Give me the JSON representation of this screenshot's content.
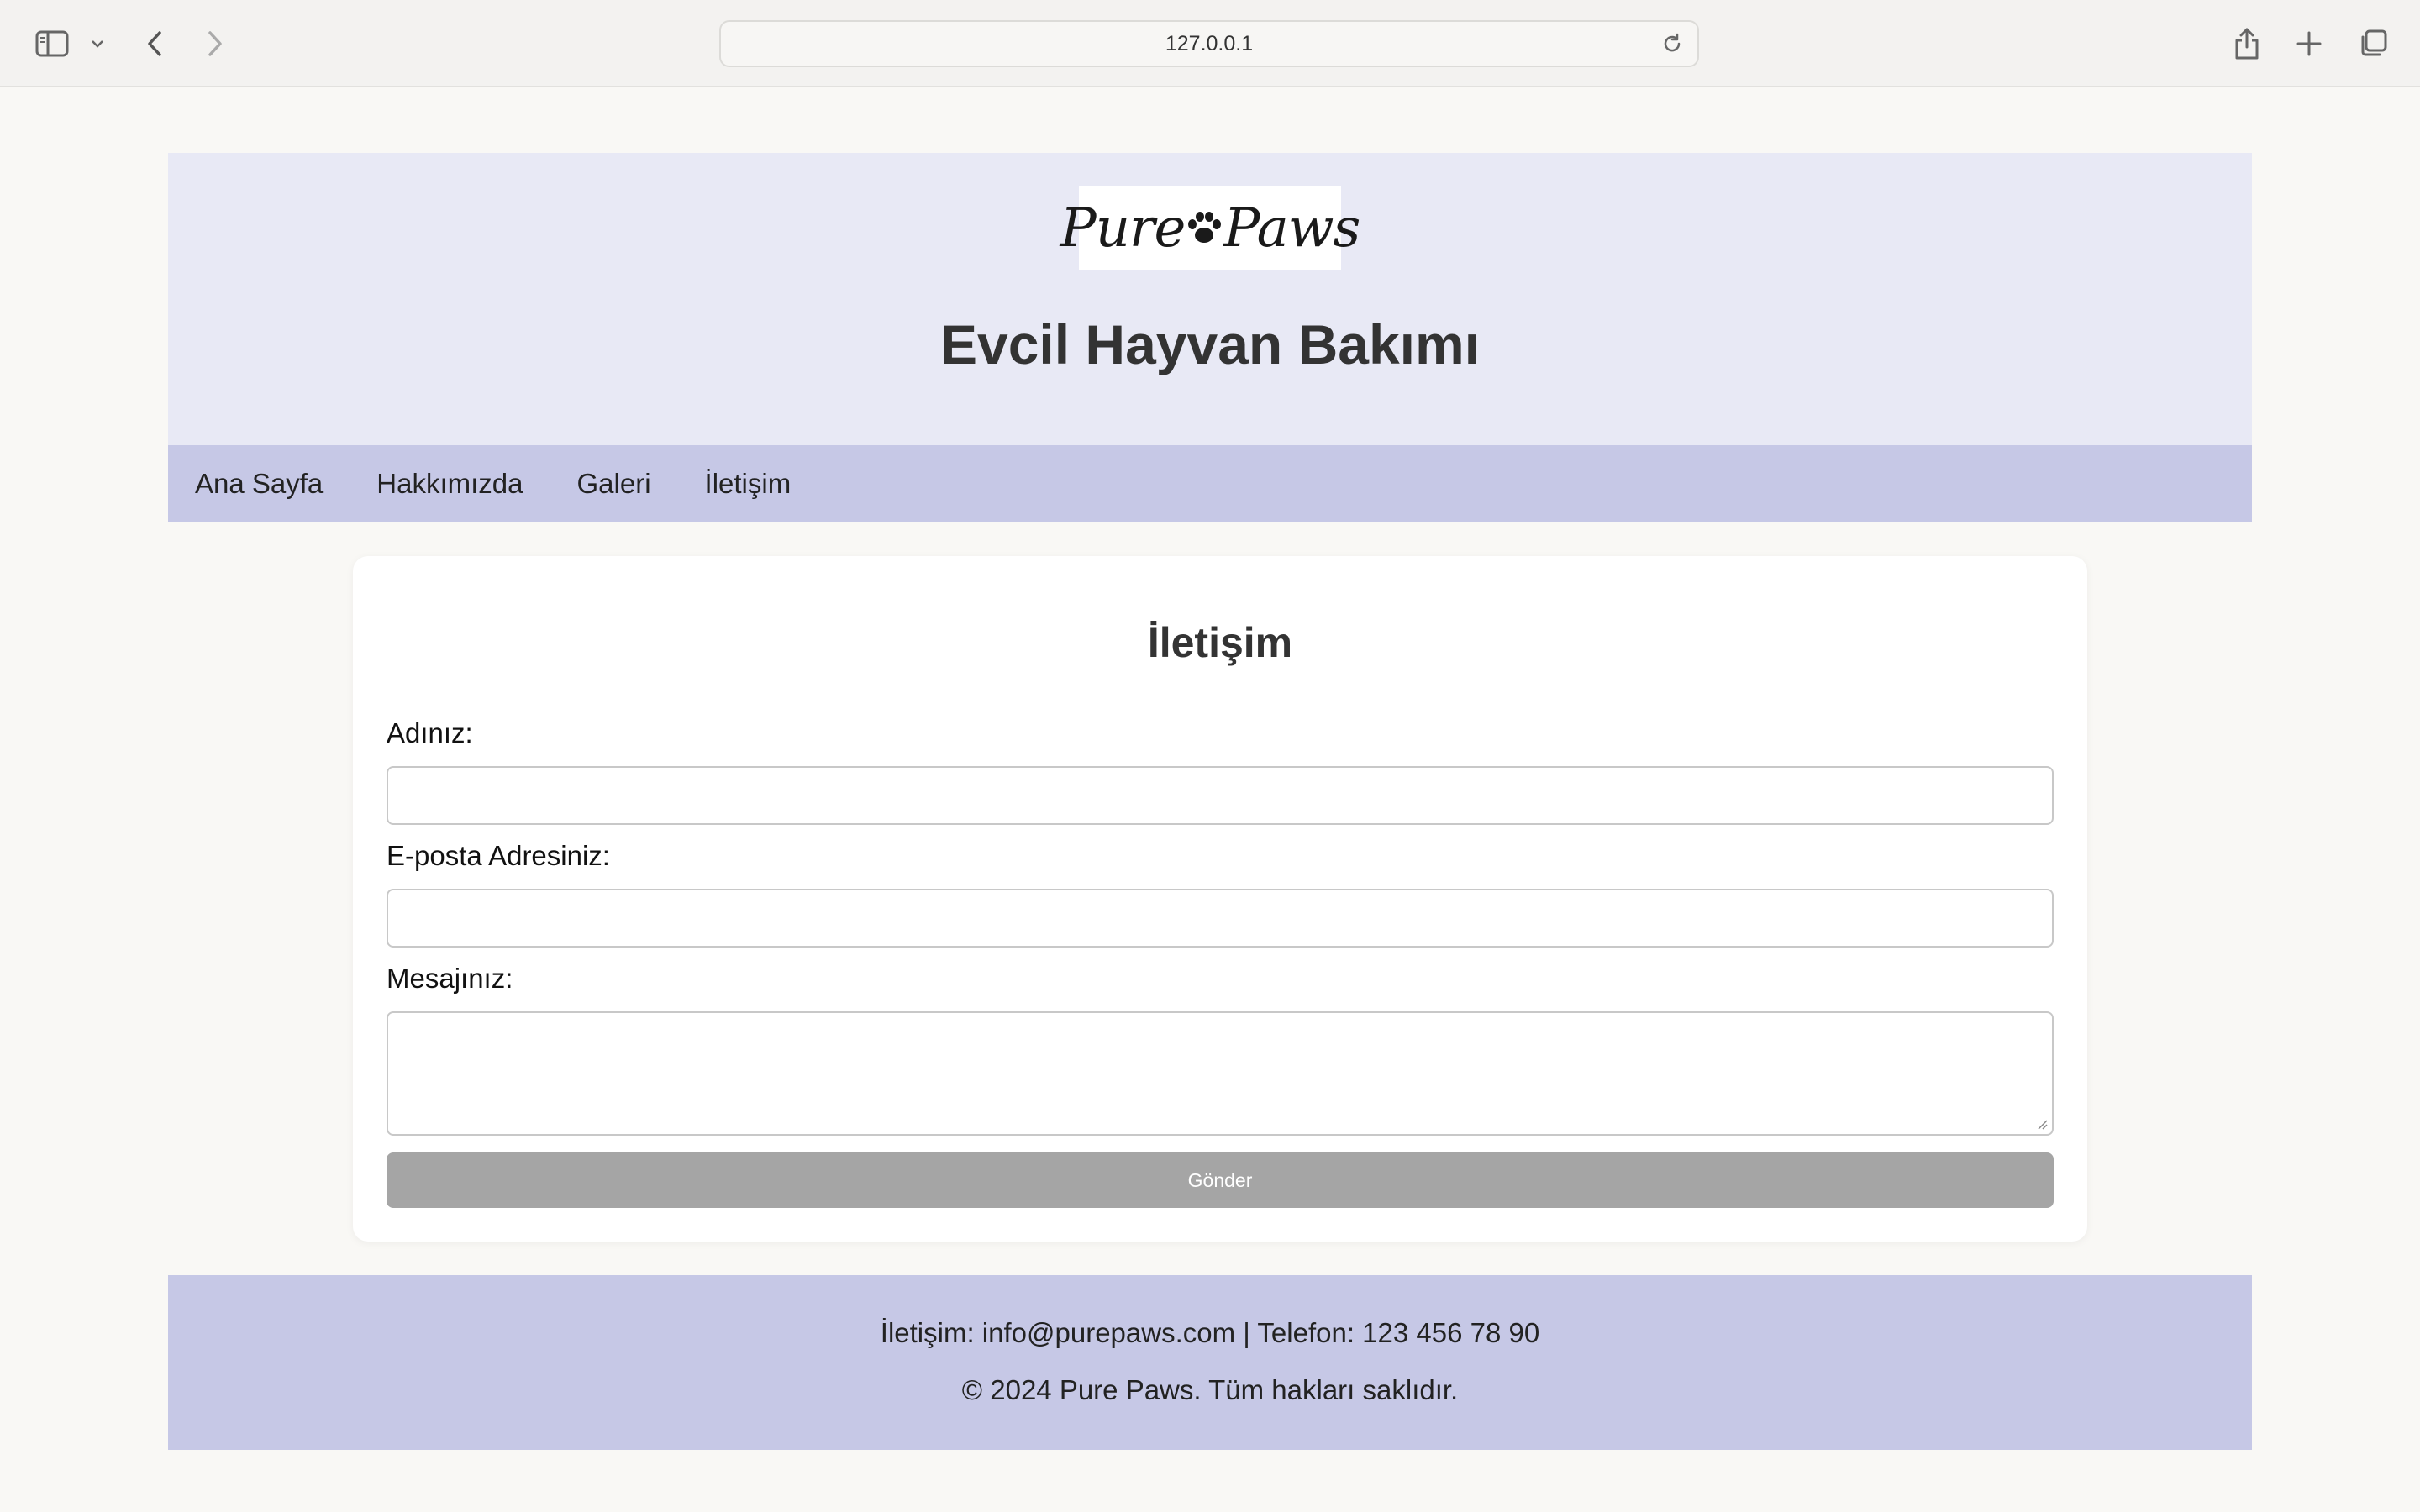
{
  "browser": {
    "url": "127.0.0.1",
    "icons": [
      "sidebar-icon",
      "chevron-down-icon",
      "back-icon",
      "forward-icon",
      "reload-icon",
      "share-icon",
      "new-tab-icon",
      "tabs-overview-icon"
    ]
  },
  "header": {
    "logo_text_left": "Pure",
    "logo_text_right": "Paws",
    "title": "Evcil Hayvan Bakımı"
  },
  "nav": {
    "items": [
      {
        "label": "Ana Sayfa"
      },
      {
        "label": "Hakkımızda"
      },
      {
        "label": "Galeri"
      },
      {
        "label": "İletişim"
      }
    ]
  },
  "contact_form": {
    "title": "İletişim",
    "name_label": "Adınız:",
    "email_label": "E-posta Adresiniz:",
    "message_label": "Mesajınız:",
    "name_value": "",
    "email_value": "",
    "message_value": "",
    "submit_label": "Gönder"
  },
  "footer": {
    "contact_line": "İletişim: info@purepaws.com | Telefon: 123 456 78 90",
    "copyright": "© 2024 Pure Paws. Tüm hakları saklıdır."
  }
}
